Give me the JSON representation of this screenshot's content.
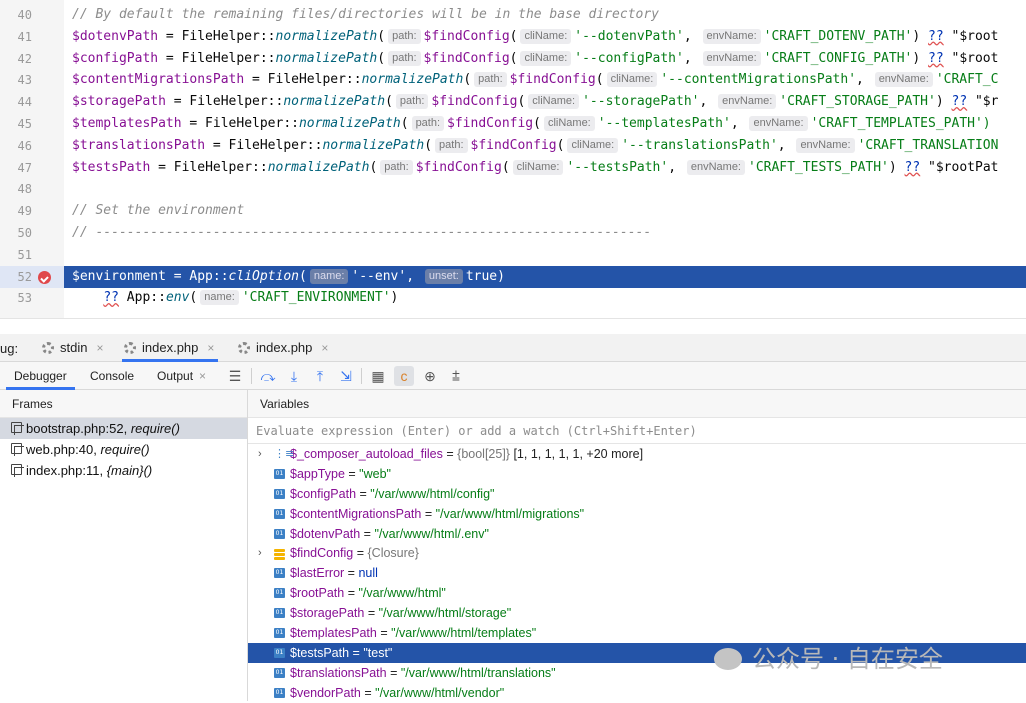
{
  "editor": {
    "lines": [
      {
        "num": "40",
        "tokens": [
          {
            "t": "// By default the remaining files/directories will be in the base directory",
            "c": "com"
          }
        ]
      },
      {
        "num": "41",
        "tokens": [
          {
            "t": "$dotenvPath",
            "c": "var"
          },
          {
            "t": " = FileHelper::",
            "c": ""
          },
          {
            "t": "normalizePath",
            "c": "fn"
          },
          {
            "t": "(",
            "c": ""
          },
          {
            "hint": "path:"
          },
          {
            "t": "$findConfig",
            "c": "var"
          },
          {
            "t": "(",
            "c": ""
          },
          {
            "hint": "cliName:"
          },
          {
            "t": "'--dotenvPath'",
            "c": "str"
          },
          {
            "t": ", ",
            "c": ""
          },
          {
            "hint": "envName:"
          },
          {
            "t": "'CRAFT_DOTENV_PATH'",
            "c": "str"
          },
          {
            "t": ") ",
            "c": ""
          },
          {
            "t": "??",
            "c": "kw"
          },
          {
            "t": " \"$root",
            "c": ""
          }
        ]
      },
      {
        "num": "42",
        "tokens": [
          {
            "t": "$configPath",
            "c": "var"
          },
          {
            "t": " = FileHelper::",
            "c": ""
          },
          {
            "t": "normalizePath",
            "c": "fn"
          },
          {
            "t": "(",
            "c": ""
          },
          {
            "hint": "path:"
          },
          {
            "t": "$findConfig",
            "c": "var"
          },
          {
            "t": "(",
            "c": ""
          },
          {
            "hint": "cliName:"
          },
          {
            "t": "'--configPath'",
            "c": "str"
          },
          {
            "t": ", ",
            "c": ""
          },
          {
            "hint": "envName:"
          },
          {
            "t": "'CRAFT_CONFIG_PATH'",
            "c": "str"
          },
          {
            "t": ") ",
            "c": ""
          },
          {
            "t": "??",
            "c": "kw"
          },
          {
            "t": " \"$root",
            "c": ""
          }
        ]
      },
      {
        "num": "43",
        "tokens": [
          {
            "t": "$contentMigrationsPath",
            "c": "var"
          },
          {
            "t": " = FileHelper::",
            "c": ""
          },
          {
            "t": "normalizePath",
            "c": "fn"
          },
          {
            "t": "(",
            "c": ""
          },
          {
            "hint": "path:"
          },
          {
            "t": "$findConfig",
            "c": "var"
          },
          {
            "t": "(",
            "c": ""
          },
          {
            "hint": "cliName:"
          },
          {
            "t": "'--contentMigrationsPath'",
            "c": "str"
          },
          {
            "t": ", ",
            "c": ""
          },
          {
            "hint": "envName:"
          },
          {
            "t": "'CRAFT_C",
            "c": "str"
          }
        ]
      },
      {
        "num": "44",
        "tokens": [
          {
            "t": "$storagePath",
            "c": "var"
          },
          {
            "t": " = FileHelper::",
            "c": ""
          },
          {
            "t": "normalizePath",
            "c": "fn"
          },
          {
            "t": "(",
            "c": ""
          },
          {
            "hint": "path:"
          },
          {
            "t": "$findConfig",
            "c": "var"
          },
          {
            "t": "(",
            "c": ""
          },
          {
            "hint": "cliName:"
          },
          {
            "t": "'--storagePath'",
            "c": "str"
          },
          {
            "t": ", ",
            "c": ""
          },
          {
            "hint": "envName:"
          },
          {
            "t": "'CRAFT_STORAGE_PATH'",
            "c": "str"
          },
          {
            "t": ") ",
            "c": ""
          },
          {
            "t": "??",
            "c": "kw"
          },
          {
            "t": " \"$r",
            "c": ""
          }
        ]
      },
      {
        "num": "45",
        "tokens": [
          {
            "t": "$templatesPath",
            "c": "var"
          },
          {
            "t": " = FileHelper::",
            "c": ""
          },
          {
            "t": "normalizePath",
            "c": "fn"
          },
          {
            "t": "(",
            "c": ""
          },
          {
            "hint": "path:"
          },
          {
            "t": "$findConfig",
            "c": "var"
          },
          {
            "t": "(",
            "c": ""
          },
          {
            "hint": "cliName:"
          },
          {
            "t": "'--templatesPath'",
            "c": "str"
          },
          {
            "t": ", ",
            "c": ""
          },
          {
            "hint": "envName:"
          },
          {
            "t": "'CRAFT_TEMPLATES_PATH')",
            "c": "str"
          }
        ]
      },
      {
        "num": "46",
        "tokens": [
          {
            "t": "$translationsPath",
            "c": "var"
          },
          {
            "t": " = FileHelper::",
            "c": ""
          },
          {
            "t": "normalizePath",
            "c": "fn"
          },
          {
            "t": "(",
            "c": ""
          },
          {
            "hint": "path:"
          },
          {
            "t": "$findConfig",
            "c": "var"
          },
          {
            "t": "(",
            "c": ""
          },
          {
            "hint": "cliName:"
          },
          {
            "t": "'--translationsPath'",
            "c": "str"
          },
          {
            "t": ", ",
            "c": ""
          },
          {
            "hint": "envName:"
          },
          {
            "t": "'CRAFT_TRANSLATION",
            "c": "str"
          }
        ]
      },
      {
        "num": "47",
        "tokens": [
          {
            "t": "$testsPath",
            "c": "var"
          },
          {
            "t": " = FileHelper::",
            "c": ""
          },
          {
            "t": "normalizePath",
            "c": "fn"
          },
          {
            "t": "(",
            "c": ""
          },
          {
            "hint": "path:"
          },
          {
            "t": "$findConfig",
            "c": "var"
          },
          {
            "t": "(",
            "c": ""
          },
          {
            "hint": "cliName:"
          },
          {
            "t": "'--testsPath'",
            "c": "str"
          },
          {
            "t": ", ",
            "c": ""
          },
          {
            "hint": "envName:"
          },
          {
            "t": "'CRAFT_TESTS_PATH'",
            "c": "str"
          },
          {
            "t": ") ",
            "c": ""
          },
          {
            "t": "??",
            "c": "kw"
          },
          {
            "t": " \"$rootPat",
            "c": ""
          }
        ]
      },
      {
        "num": "48",
        "tokens": []
      },
      {
        "num": "49",
        "tokens": [
          {
            "t": "// Set the environment",
            "c": "com"
          }
        ]
      },
      {
        "num": "50",
        "tokens": [
          {
            "t": "// -----------------------------------------------------------------------",
            "c": "com"
          }
        ]
      },
      {
        "num": "51",
        "tokens": []
      },
      {
        "num": "52",
        "breakpoint": true,
        "highlight": true,
        "tokens": [
          {
            "t": "$environment",
            "c": "var"
          },
          {
            "t": " = App::",
            "c": ""
          },
          {
            "t": "cliOption",
            "c": "fn"
          },
          {
            "t": "(",
            "c": ""
          },
          {
            "hint": "name:"
          },
          {
            "t": "'--env'",
            "c": "str"
          },
          {
            "t": ", ",
            "c": ""
          },
          {
            "hint": "unset:"
          },
          {
            "t": "true)",
            "c": ""
          }
        ]
      },
      {
        "num": "53",
        "tokens": [
          {
            "t": "    ",
            "c": ""
          },
          {
            "t": "??",
            "c": "kw"
          },
          {
            "t": " App::",
            "c": ""
          },
          {
            "t": "env",
            "c": "fn"
          },
          {
            "t": "(",
            "c": ""
          },
          {
            "hint": "name:"
          },
          {
            "t": "'CRAFT_ENVIRONMENT'",
            "c": "str"
          },
          {
            "t": ")",
            "c": ""
          }
        ]
      }
    ]
  },
  "debug": {
    "title": "ug:",
    "tabs": [
      {
        "label": "stdin"
      },
      {
        "label": "index.php"
      },
      {
        "label": "index.php"
      }
    ],
    "subtabs": {
      "debugger": "Debugger",
      "console": "Console",
      "output": "Output"
    },
    "frames_header": "Frames",
    "variables_header": "Variables",
    "eval_placeholder": "Evaluate expression (Enter) or add a watch (Ctrl+Shift+Enter)",
    "frames": [
      {
        "file": "bootstrap.php:52, ",
        "fn": "require()"
      },
      {
        "file": "web.php:40, ",
        "fn": "require()"
      },
      {
        "file": "index.php:11, ",
        "fn": "{main}()"
      }
    ],
    "variables": [
      {
        "name": "$_composer_autoload_files",
        "eq": " = ",
        "type": "{bool[25]} ",
        "value": "[1, 1, 1, 1, 1, +20 more]",
        "kind": "list",
        "expandable": true
      },
      {
        "name": "$appType",
        "eq": " = ",
        "value": "\"web\"",
        "kind": "str"
      },
      {
        "name": "$configPath",
        "eq": " = ",
        "value": "\"/var/www/html/config\"",
        "kind": "str"
      },
      {
        "name": "$contentMigrationsPath",
        "eq": " = ",
        "value": "\"/var/www/html/migrations\"",
        "kind": "str"
      },
      {
        "name": "$dotenvPath",
        "eq": " = ",
        "value": "\"/var/www/html/.env\"",
        "kind": "str"
      },
      {
        "name": "$findConfig",
        "eq": " = ",
        "type": "{Closure}",
        "value": "",
        "kind": "obj",
        "expandable": true
      },
      {
        "name": "$lastError",
        "eq": " = ",
        "value": "null",
        "kind": "null"
      },
      {
        "name": "$rootPath",
        "eq": " = ",
        "value": "\"/var/www/html\"",
        "kind": "str"
      },
      {
        "name": "$storagePath",
        "eq": " = ",
        "value": "\"/var/www/html/storage\"",
        "kind": "str"
      },
      {
        "name": "$templatesPath",
        "eq": " = ",
        "value": "\"/var/www/html/templates\"",
        "kind": "str"
      },
      {
        "name": "$testsPath",
        "eq": " = ",
        "value": "\"test\"",
        "kind": "str",
        "selected": true
      },
      {
        "name": "$translationsPath",
        "eq": " = ",
        "value": "\"/var/www/html/translations\"",
        "kind": "str"
      },
      {
        "name": "$vendorPath",
        "eq": " = ",
        "value": "\"/var/www/html/vendor\"",
        "kind": "str"
      }
    ],
    "var_icon_text": "01"
  },
  "watermark": "公众号 · 自在安全",
  "colors": {
    "accent": "#3574f0",
    "selection": "#2454a8",
    "breakpoint": "#e0484b"
  }
}
